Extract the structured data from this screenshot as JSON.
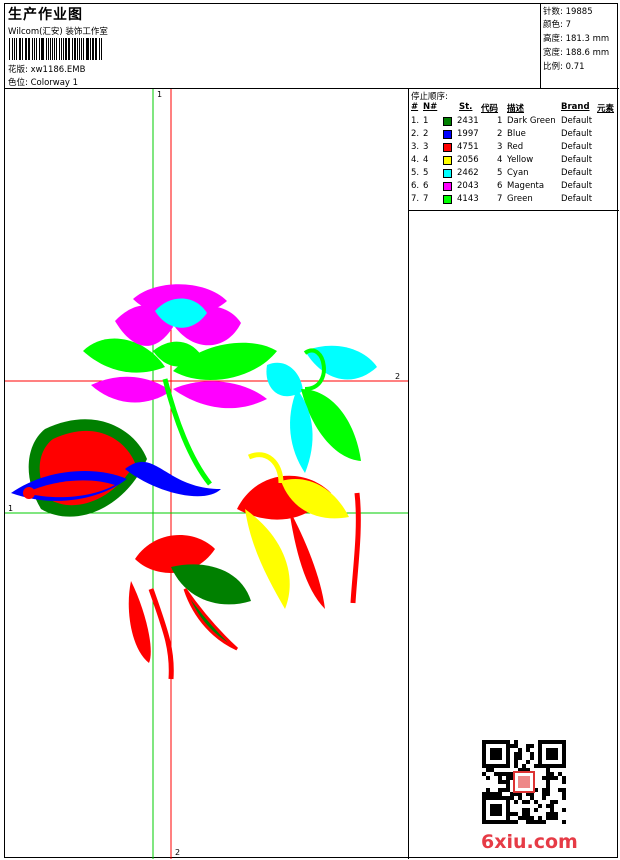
{
  "header": {
    "title": "生产作业图",
    "company": "Wilcom(汇安) 装饰工作室",
    "design_label": "花版:",
    "design_value": "xw1186.EMB",
    "colorway_label": "色位:",
    "colorway_value": "Colorway 1"
  },
  "stats": [
    {
      "label": "针数:",
      "value": "19885"
    },
    {
      "label": "颜色:",
      "value": "7"
    },
    {
      "label": "高度:",
      "value": "181.3 mm"
    },
    {
      "label": "宽度:",
      "value": "188.6 mm"
    },
    {
      "label": "比例:",
      "value": "0.71"
    }
  ],
  "stop_sequence": {
    "title": "停止顺序:",
    "headers": {
      "num": "#",
      "n": "N#",
      "st": "St.",
      "code": "代码",
      "desc": "描述",
      "brand": "Brand",
      "elements": "元素"
    },
    "rows": [
      {
        "num": "1.",
        "n": "1",
        "color": "#008000",
        "st": "2431",
        "code": "1",
        "desc": "Dark Green",
        "brand": "Default"
      },
      {
        "num": "2.",
        "n": "2",
        "color": "#0000ff",
        "st": "1997",
        "code": "2",
        "desc": "Blue",
        "brand": "Default"
      },
      {
        "num": "3.",
        "n": "3",
        "color": "#ff0000",
        "st": "4751",
        "code": "3",
        "desc": "Red",
        "brand": "Default"
      },
      {
        "num": "4.",
        "n": "4",
        "color": "#ffff00",
        "st": "2056",
        "code": "4",
        "desc": "Yellow",
        "brand": "Default"
      },
      {
        "num": "5.",
        "n": "5",
        "color": "#00ffff",
        "st": "2462",
        "code": "5",
        "desc": "Cyan",
        "brand": "Default"
      },
      {
        "num": "6.",
        "n": "6",
        "color": "#ff00ff",
        "st": "2043",
        "code": "6",
        "desc": "Magenta",
        "brand": "Default"
      },
      {
        "num": "7.",
        "n": "7",
        "color": "#00ff00",
        "st": "4143",
        "code": "7",
        "desc": "Green",
        "brand": "Default"
      }
    ]
  },
  "guides": {
    "green_label": "1",
    "red_label": "2",
    "red_h_label": "2",
    "green_h_label": "1"
  },
  "watermark": {
    "site": "6xiu.com"
  }
}
